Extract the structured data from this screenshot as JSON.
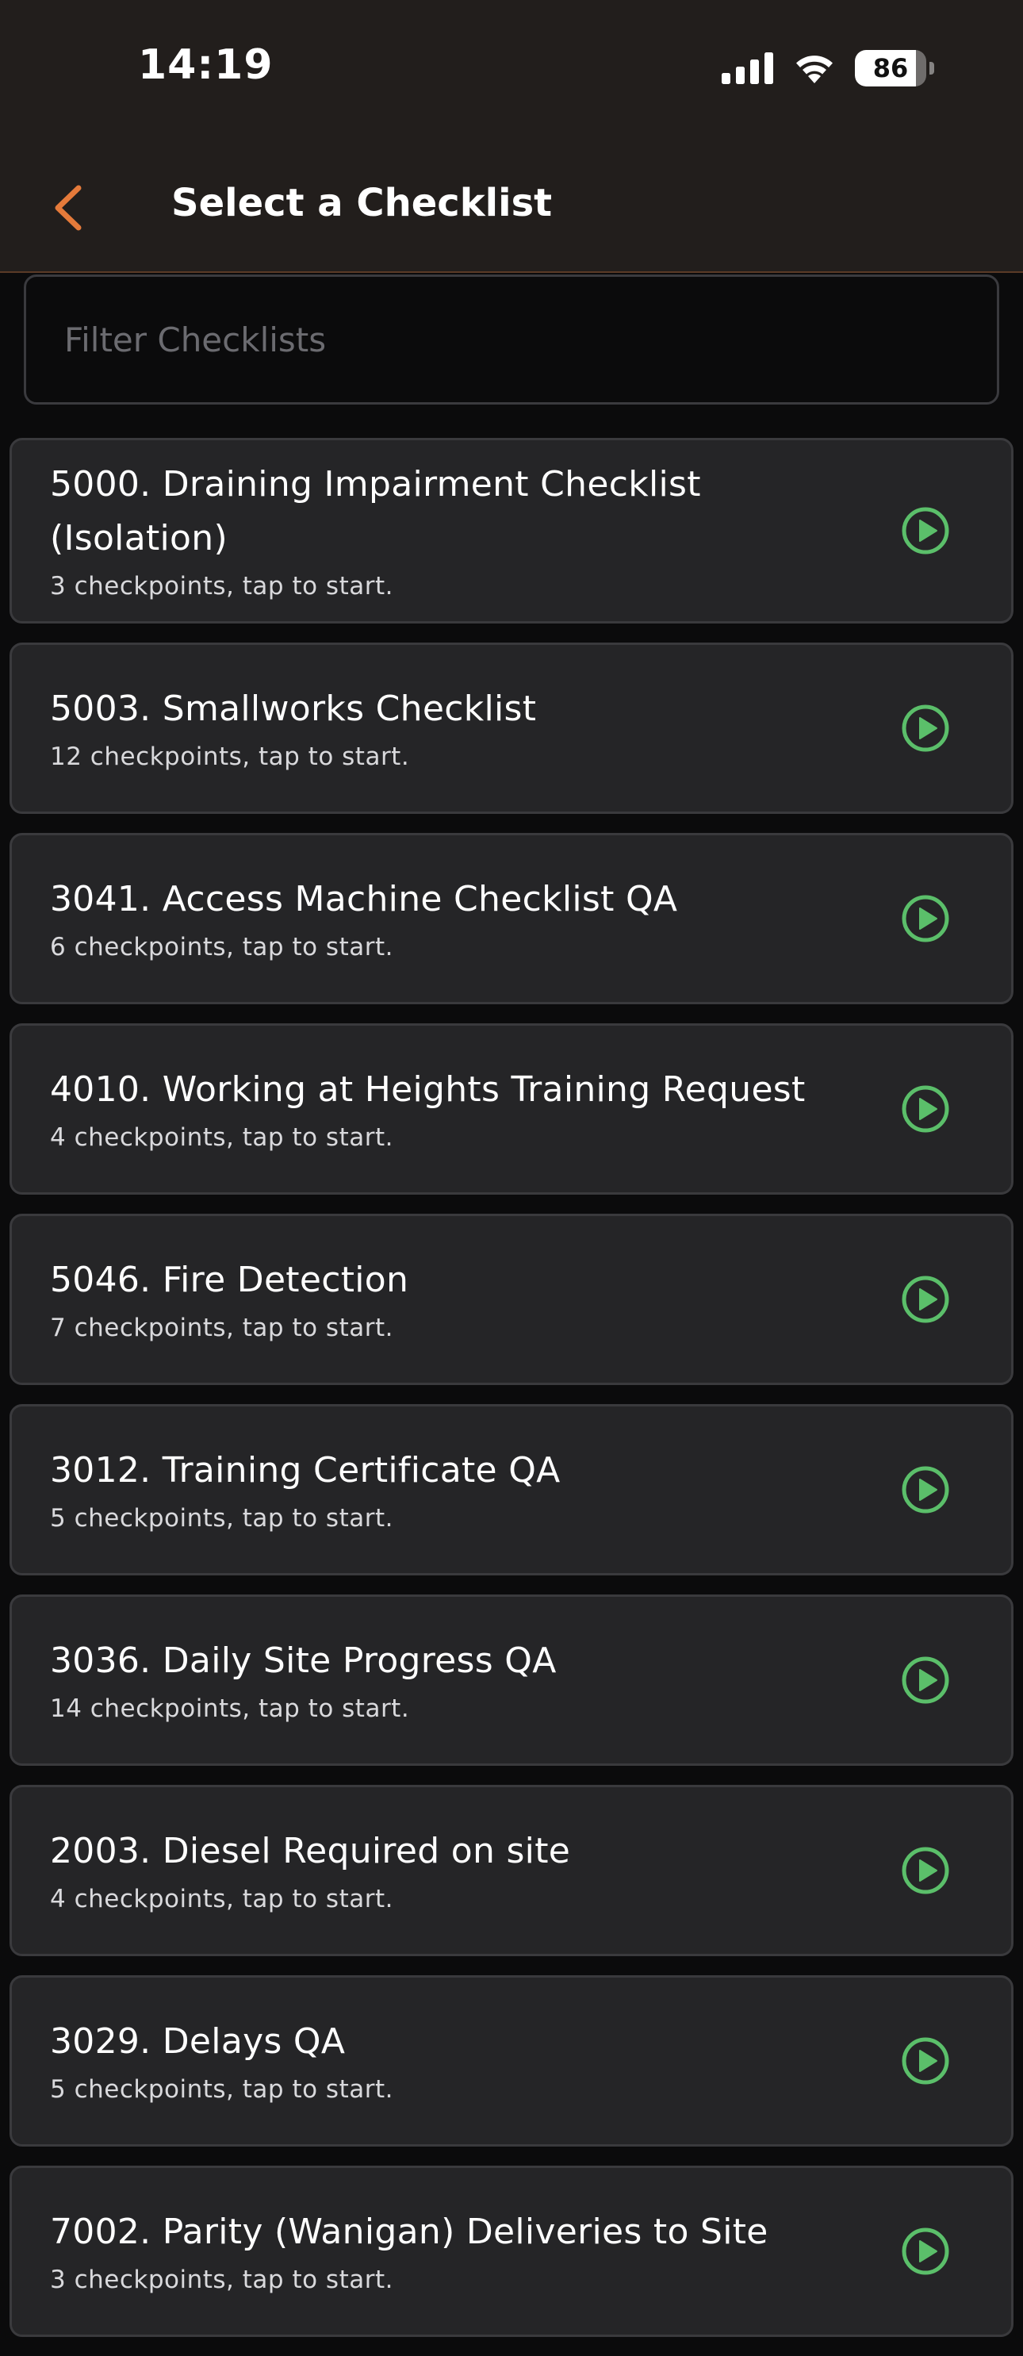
{
  "status_bar": {
    "time": "14:19",
    "battery_level": "86",
    "battery_fraction": 0.86
  },
  "header": {
    "title": "Select a Checklist",
    "back_icon": "chevron-left-icon"
  },
  "filter": {
    "placeholder": "Filter Checklists",
    "value": ""
  },
  "colors": {
    "accent": "#e57a3a",
    "play": "#5bbf6a",
    "card_bg": "#252527",
    "header_bg": "#221e1c"
  },
  "checklists": [
    {
      "title": "5000. Draining Impairment Checklist (Isolation)",
      "subtitle": "3 checkpoints, tap to start."
    },
    {
      "title": "5003. Smallworks Checklist",
      "subtitle": "12 checkpoints, tap to start."
    },
    {
      "title": "3041. Access Machine Checklist QA",
      "subtitle": "6 checkpoints, tap to start."
    },
    {
      "title": "4010. Working at Heights Training Request",
      "subtitle": "4 checkpoints, tap to start."
    },
    {
      "title": "5046. Fire Detection",
      "subtitle": "7 checkpoints, tap to start."
    },
    {
      "title": "3012. Training Certificate QA",
      "subtitle": "5 checkpoints, tap to start."
    },
    {
      "title": "3036. Daily Site Progress QA",
      "subtitle": "14 checkpoints, tap to start."
    },
    {
      "title": "2003. Diesel Required on site",
      "subtitle": "4 checkpoints, tap to start."
    },
    {
      "title": "3029. Delays QA",
      "subtitle": "5 checkpoints, tap to start."
    },
    {
      "title": "7002. Parity (Wanigan) Deliveries to Site",
      "subtitle": "3 checkpoints, tap to start."
    }
  ]
}
